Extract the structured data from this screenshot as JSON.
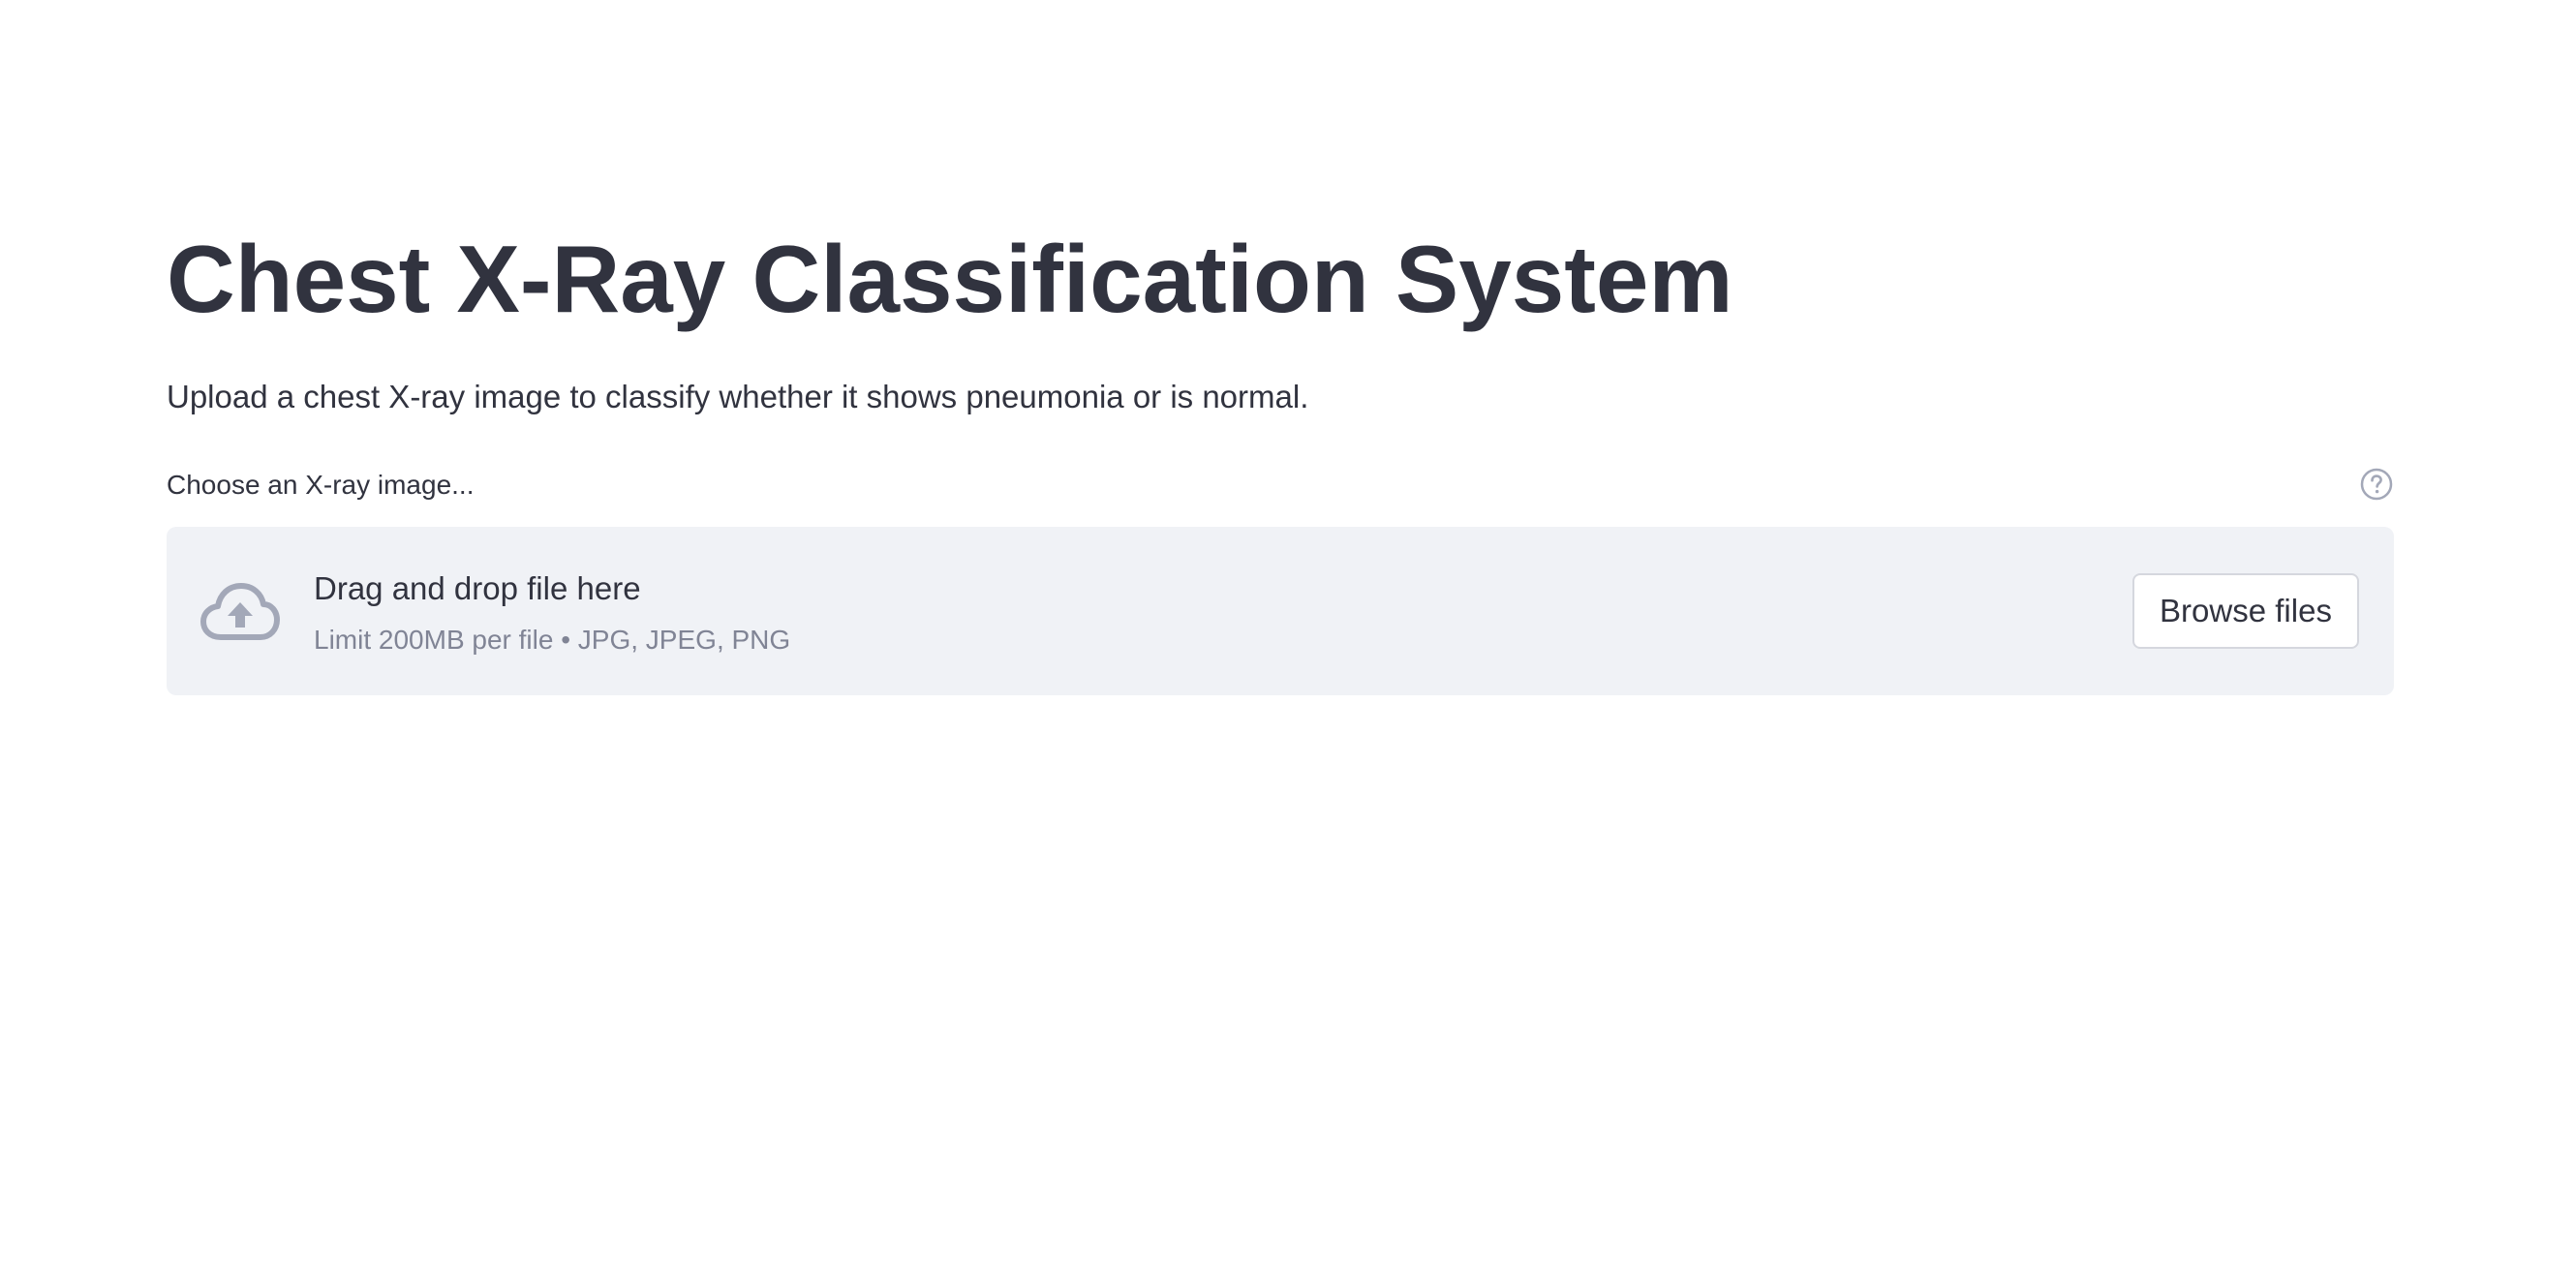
{
  "header": {
    "title": "Chest X-Ray Classification System",
    "subtitle": "Upload a chest X-ray image to classify whether it shows pneumonia or is normal."
  },
  "uploader": {
    "label": "Choose an X-ray image...",
    "help_icon": "question-circle-icon",
    "dropzone": {
      "icon": "cloud-upload-icon",
      "primary_text": "Drag and drop file here",
      "secondary_text": "Limit 200MB per file • JPG, JPEG, PNG"
    },
    "browse_label": "Browse files"
  },
  "colors": {
    "text": "#31333f",
    "muted_text": "#808495",
    "dropzone_bg": "#f0f2f6",
    "icon": "#a3a8b8"
  }
}
